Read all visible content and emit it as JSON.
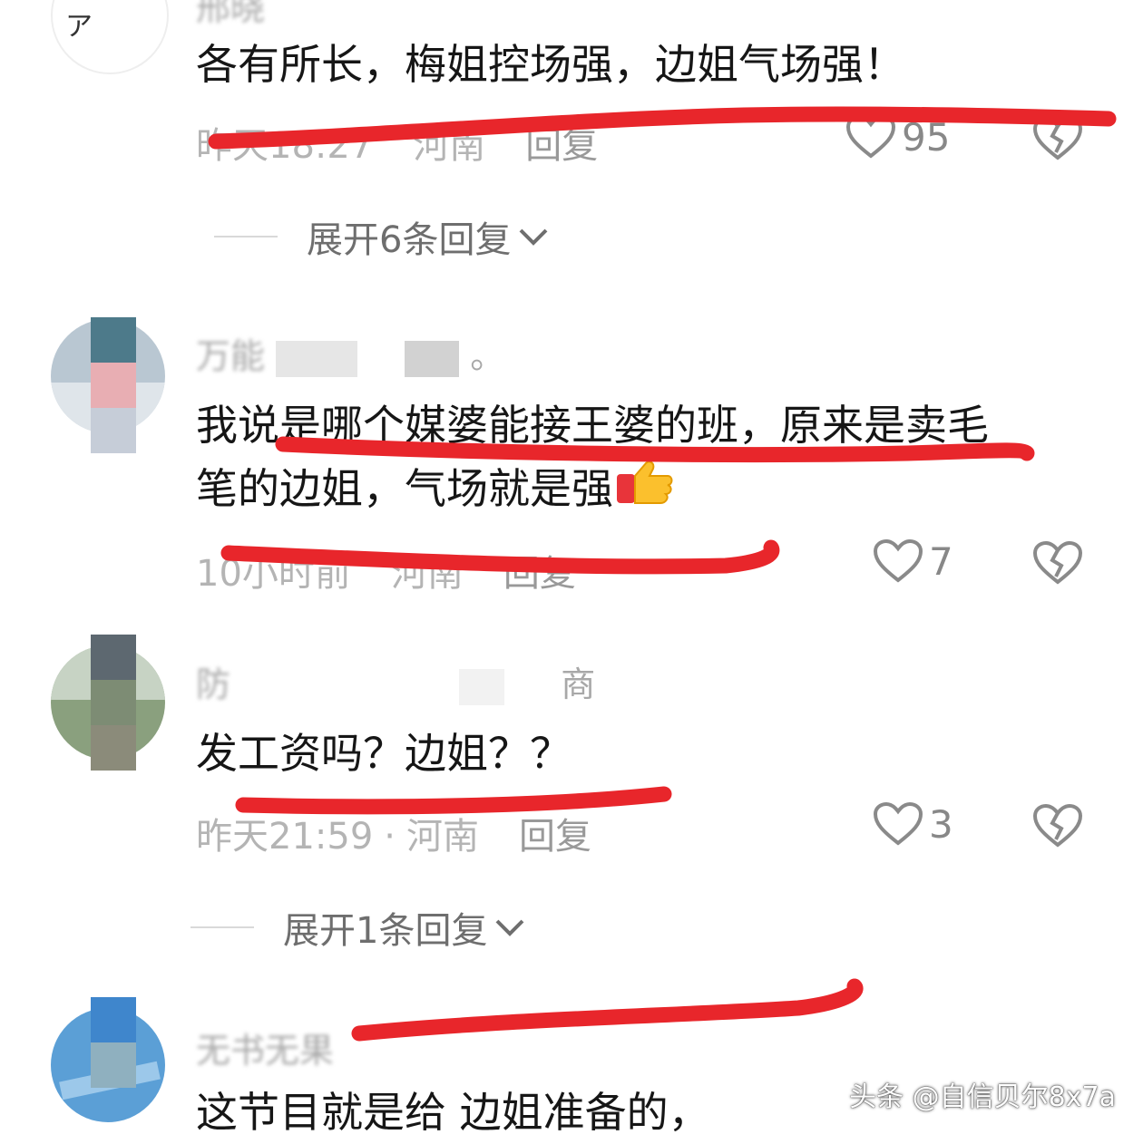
{
  "comments": [
    {
      "name": "邢晓",
      "content": "各有所长，梅姐控场强，边姐气场强！",
      "time": "昨天18:27",
      "location": "河南",
      "reply": "回复",
      "likes": "95"
    },
    {
      "name": "万能",
      "name_tail": "。",
      "content_line1": "我说是哪个媒婆能接王婆的班，原来是卖毛",
      "content_line2": "笔的边姐，气场就是强",
      "time": "10小时前",
      "location": "河南",
      "reply": "回复",
      "likes": "7"
    },
    {
      "name": "防",
      "name_tail": "商",
      "content": "发工资吗？边姐？？",
      "time": "昨天21:59",
      "separator": "·",
      "location": "河南",
      "reply": "回复",
      "likes": "3"
    },
    {
      "name": "无书无果",
      "content": "这节目就是给 边姐准备的，"
    }
  ],
  "expand": [
    {
      "label": "展开6条回复"
    },
    {
      "label": "展开1条回复"
    }
  ],
  "watermark": "头条 @自信贝尔8x7a",
  "colors": {
    "annotation_red": "#e8262b",
    "meta_gray": "#b4b4b4",
    "expand_gray": "#6e6e6e"
  },
  "icons": [
    "like-heart-icon",
    "dislike-broken-heart-icon",
    "chevron-down-icon",
    "thumbs-up-emoji"
  ]
}
